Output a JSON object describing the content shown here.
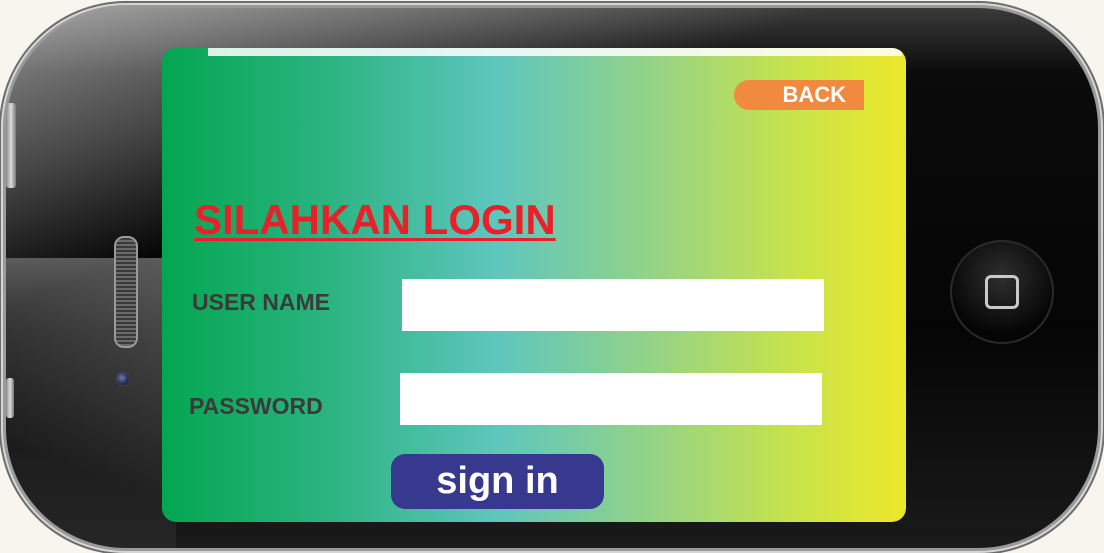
{
  "screen": {
    "back_label": "BACK",
    "title": "SILAHKAN LOGIN",
    "username_label": "USER NAME",
    "username_value": "",
    "password_label": "PASSWORD",
    "password_value": "",
    "signin_label": "sign in"
  },
  "colors": {
    "title": "#e8202a",
    "back_button": "#f18a3f",
    "signin_button": "#37398f",
    "gradient_start": "#04a650",
    "gradient_end": "#ede72a"
  },
  "icons": {
    "home_button": "home-square-icon"
  }
}
